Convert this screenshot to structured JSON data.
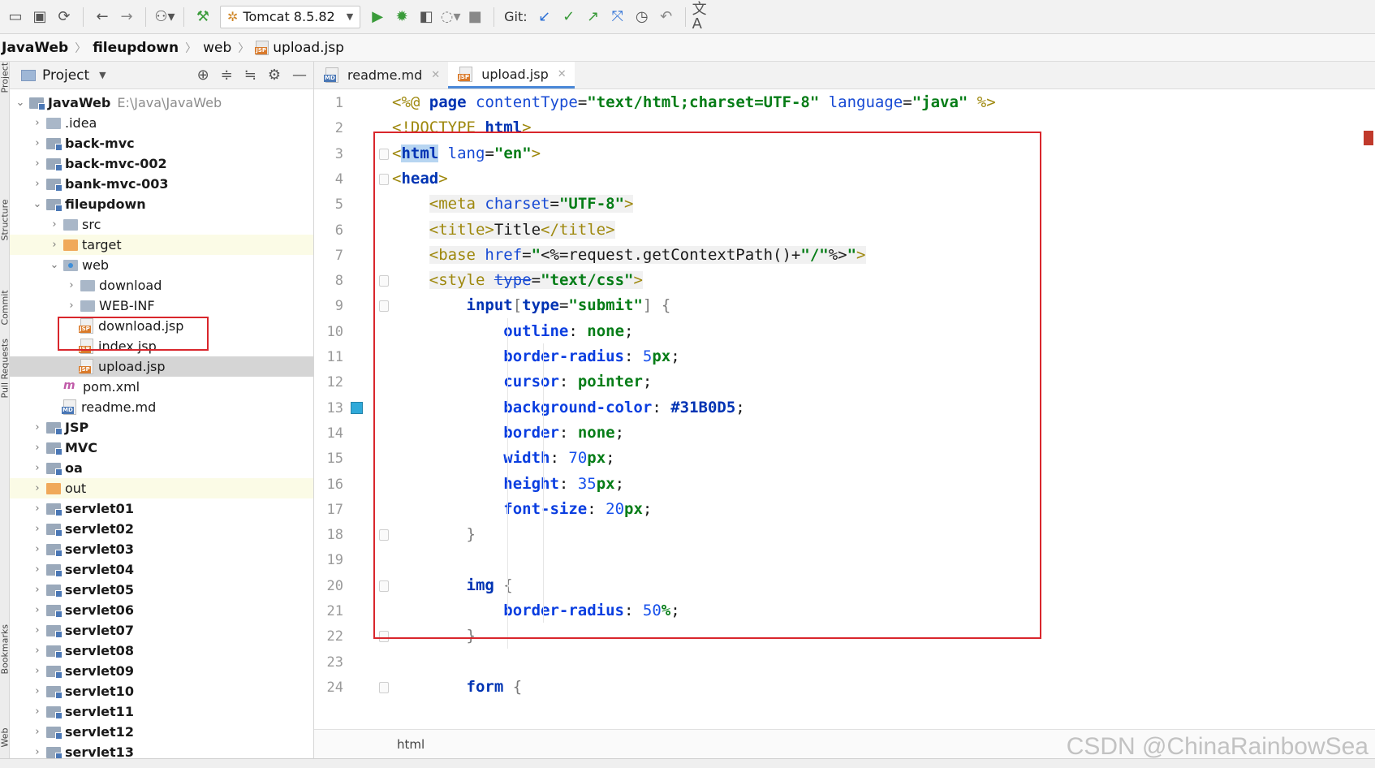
{
  "toolbar": {
    "run_config": "Tomcat 8.5.82",
    "git_label": "Git:"
  },
  "breadcrumb": [
    "JavaWeb",
    "fileupdown",
    "web",
    "upload.jsp"
  ],
  "side_strip": [
    "Project",
    "Structure",
    "Commit",
    "Pull Requests",
    "Bookmarks",
    "Web"
  ],
  "project_panel": {
    "title": "Project",
    "tree": [
      {
        "label": "JavaWeb",
        "path": "E:\\Java\\JavaWeb",
        "icon": "module-folder",
        "bold": true,
        "depth": 0,
        "arrow": "open"
      },
      {
        "label": ".idea",
        "icon": "folder",
        "depth": 1,
        "arrow": "closed"
      },
      {
        "label": "back-mvc",
        "icon": "module-folder",
        "bold": true,
        "depth": 1,
        "arrow": "closed"
      },
      {
        "label": "back-mvc-002",
        "icon": "module-folder",
        "bold": true,
        "depth": 1,
        "arrow": "closed"
      },
      {
        "label": "bank-mvc-003",
        "icon": "module-folder",
        "bold": true,
        "depth": 1,
        "arrow": "closed"
      },
      {
        "label": "fileupdown",
        "icon": "module-folder",
        "bold": true,
        "depth": 1,
        "arrow": "open"
      },
      {
        "label": "src",
        "icon": "folder",
        "depth": 2,
        "arrow": "closed"
      },
      {
        "label": "target",
        "icon": "excluded-folder",
        "depth": 2,
        "arrow": "closed",
        "highlight": true
      },
      {
        "label": "web",
        "icon": "web-folder",
        "depth": 2,
        "arrow": "open"
      },
      {
        "label": "download",
        "icon": "folder",
        "depth": 3,
        "arrow": "closed"
      },
      {
        "label": "WEB-INF",
        "icon": "folder",
        "depth": 3,
        "arrow": "closed"
      },
      {
        "label": "download.jsp",
        "icon": "jsp-file",
        "depth": 3
      },
      {
        "label": "index.jsp",
        "icon": "jsp-file",
        "depth": 3
      },
      {
        "label": "upload.jsp",
        "icon": "jsp-file",
        "depth": 3,
        "selected": true
      },
      {
        "label": "pom.xml",
        "icon": "maven-file",
        "depth": 2
      },
      {
        "label": "readme.md",
        "icon": "markdown-file",
        "depth": 2
      },
      {
        "label": "JSP",
        "icon": "module-folder",
        "bold": true,
        "depth": 1,
        "arrow": "closed"
      },
      {
        "label": "MVC",
        "icon": "module-folder",
        "bold": true,
        "depth": 1,
        "arrow": "closed"
      },
      {
        "label": "oa",
        "icon": "module-folder",
        "bold": true,
        "depth": 1,
        "arrow": "closed"
      },
      {
        "label": "out",
        "icon": "excluded-folder",
        "depth": 1,
        "arrow": "closed",
        "highlight": true
      },
      {
        "label": "servlet01",
        "icon": "module-folder",
        "bold": true,
        "depth": 1,
        "arrow": "closed"
      },
      {
        "label": "servlet02",
        "icon": "module-folder",
        "bold": true,
        "depth": 1,
        "arrow": "closed"
      },
      {
        "label": "servlet03",
        "icon": "module-folder",
        "bold": true,
        "depth": 1,
        "arrow": "closed"
      },
      {
        "label": "servlet04",
        "icon": "module-folder",
        "bold": true,
        "depth": 1,
        "arrow": "closed"
      },
      {
        "label": "servlet05",
        "icon": "module-folder",
        "bold": true,
        "depth": 1,
        "arrow": "closed"
      },
      {
        "label": "servlet06",
        "icon": "module-folder",
        "bold": true,
        "depth": 1,
        "arrow": "closed"
      },
      {
        "label": "servlet07",
        "icon": "module-folder",
        "bold": true,
        "depth": 1,
        "arrow": "closed"
      },
      {
        "label": "servlet08",
        "icon": "module-folder",
        "bold": true,
        "depth": 1,
        "arrow": "closed"
      },
      {
        "label": "servlet09",
        "icon": "module-folder",
        "bold": true,
        "depth": 1,
        "arrow": "closed"
      },
      {
        "label": "servlet10",
        "icon": "module-folder",
        "bold": true,
        "depth": 1,
        "arrow": "closed"
      },
      {
        "label": "servlet11",
        "icon": "module-folder",
        "bold": true,
        "depth": 1,
        "arrow": "closed"
      },
      {
        "label": "servlet12",
        "icon": "module-folder",
        "bold": true,
        "depth": 1,
        "arrow": "closed"
      },
      {
        "label": "servlet13",
        "icon": "module-folder",
        "bold": true,
        "depth": 1,
        "arrow": "closed"
      }
    ]
  },
  "editor_tabs": [
    {
      "label": "readme.md",
      "icon": "markdown-file",
      "active": false
    },
    {
      "label": "upload.jsp",
      "icon": "jsp-file",
      "active": true
    }
  ],
  "code_lines": [
    "<%@ page contentType=\"text/html;charset=UTF-8\" language=\"java\" %>",
    "<!DOCTYPE html>",
    "<html lang=\"en\">",
    "<head>",
    "    <meta charset=\"UTF-8\">",
    "    <title>Title</title>",
    "    <base href=\"<%=request.getContextPath()+\"/\"%>\">",
    "    <style type=\"text/css\">",
    "        input[type=\"submit\"] {",
    "            outline: none;",
    "            border-radius: 5px;",
    "            cursor: pointer;",
    "            background-color: #31B0D5;",
    "            border: none;",
    "            width: 70px;",
    "            height: 35px;",
    "            font-size: 20px;",
    "        }",
    "",
    "        img {",
    "            border-radius: 50%;",
    "        }",
    "",
    "        form {"
  ],
  "line_numbers": [
    "1",
    "2",
    "3",
    "4",
    "5",
    "6",
    "7",
    "8",
    "9",
    "10",
    "11",
    "12",
    "13",
    "14",
    "15",
    "16",
    "17",
    "18",
    "19",
    "20",
    "21",
    "22",
    "23",
    "24"
  ],
  "status": {
    "context": "html"
  },
  "watermark": "CSDN @ChinaRainbowSea",
  "colors": {
    "accent_box": "#d9262c",
    "bookmark": "#2fa9d9"
  }
}
